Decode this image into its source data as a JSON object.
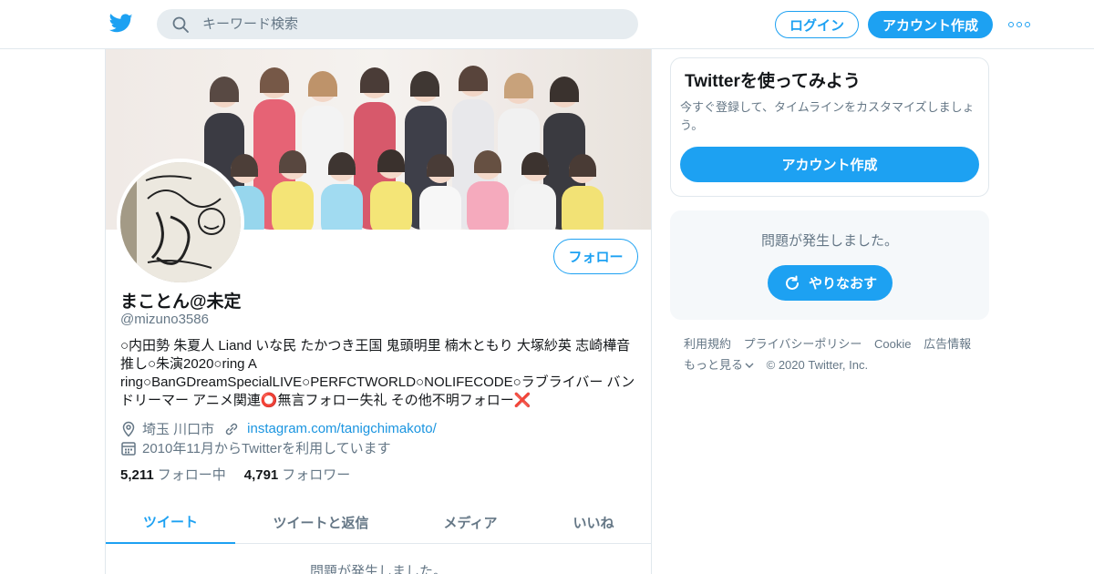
{
  "header": {
    "search_placeholder": "キーワード検索",
    "login_label": "ログイン",
    "signup_label": "アカウント作成"
  },
  "profile": {
    "follow_label": "フォロー",
    "name": "まことん@未定",
    "handle": "@mizuno3586",
    "bio": "○内田勢 朱夏人 Liand いな民 たかつき王国 鬼頭明里 楠木ともり 大塚紗英 志崎樺音推し○朱演2020○ring A ring○BanGDreamSpecialLIVE○PERFCTWORLD○NOLIFECODE○ラブライバー バンドリーマー アニメ関連⭕無言フォロー失礼 その他不明フォロー❌",
    "location": "埼玉 川口市",
    "url": "instagram.com/tanigchimakoto/",
    "joined": "2010年11月からTwitterを利用しています",
    "following_count": "5,211",
    "following_label": "フォロー中",
    "followers_count": "4,791",
    "followers_label": "フォロワー",
    "tabs": [
      {
        "label": "ツイート"
      },
      {
        "label": "ツイートと返信"
      },
      {
        "label": "メディア"
      },
      {
        "label": "いいね"
      }
    ],
    "error_text": "問題が発生しました。"
  },
  "sidebar": {
    "card_title": "Twitterを使ってみよう",
    "card_text": "今すぐ登録して、タイムラインをカスタマイズしましょう。",
    "card_button": "アカウント作成",
    "error_text": "問題が発生しました。",
    "retry_label": "やりなおす"
  },
  "footer": {
    "links": [
      "利用規約",
      "プライバシーポリシー",
      "Cookie",
      "広告情報",
      "もっと見る"
    ],
    "copyright": "© 2020 Twitter, Inc."
  },
  "colors": {
    "accent": "#1da1f2",
    "text_secondary": "#657786",
    "border": "#e1e8ed"
  }
}
